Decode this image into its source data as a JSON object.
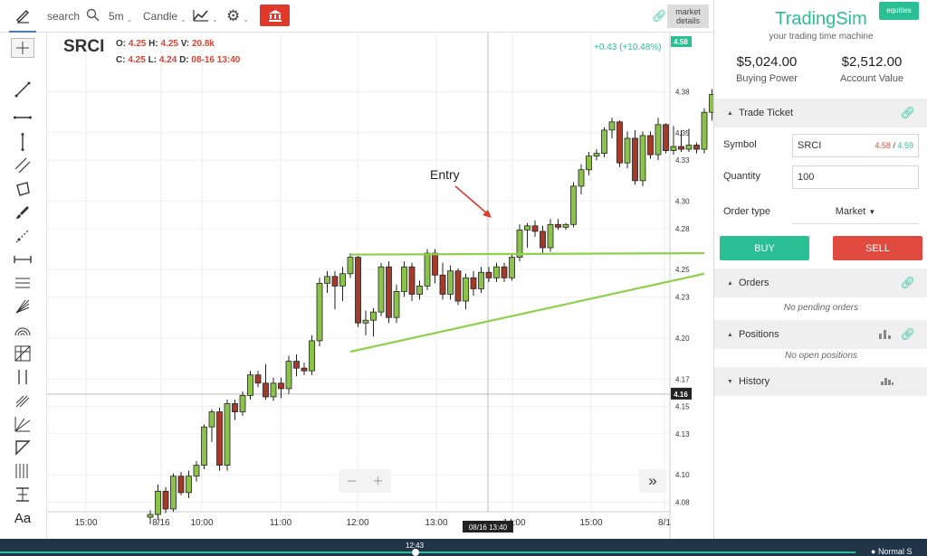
{
  "toolbar": {
    "search_label": "search",
    "interval": "5m",
    "chart_type": "Candle",
    "market_details_line1": "market",
    "market_details_line2": "details"
  },
  "symbol_header": {
    "symbol": "SRCI",
    "open_label": "O:",
    "open": "4.25",
    "high_label": "H:",
    "high": "4.25",
    "volume_label": "V:",
    "volume": "20.8k",
    "close_label": "C:",
    "close": "4.25",
    "low_label": "L:",
    "low": "4.24",
    "date_label": "D:",
    "date": "08-16 13:40",
    "change": "+0.43 (+10.48%)"
  },
  "chart_annotation": {
    "entry_label": "Entry"
  },
  "chart_data": {
    "type": "candlestick",
    "price_axis_ticks": [
      "4.38",
      "4.35",
      "4.33",
      "4.30",
      "4.28",
      "4.25",
      "4.23",
      "4.20",
      "4.17",
      "4.15",
      "4.13",
      "4.10",
      "4.08"
    ],
    "time_axis_ticks": [
      "15:00",
      "8/16",
      "10:00",
      "11:00",
      "12:00",
      "13:00",
      "14:00",
      "15:00",
      "8/1"
    ],
    "ylim": [
      4.075,
      4.42
    ],
    "last_price_label": "4.58",
    "crosshair_price_label": "4.16",
    "crosshair_price": 4.159,
    "crosshair_time_label": "08/16 13:40",
    "candles": [
      [
        4.069,
        4.074,
        4.064,
        4.071
      ],
      [
        4.071,
        4.093,
        4.067,
        4.088
      ],
      [
        4.088,
        4.091,
        4.072,
        4.075
      ],
      [
        4.075,
        4.101,
        4.073,
        4.099
      ],
      [
        4.099,
        4.102,
        4.085,
        4.087
      ],
      [
        4.087,
        4.103,
        4.083,
        4.099
      ],
      [
        4.099,
        4.11,
        4.095,
        4.107
      ],
      [
        4.107,
        4.137,
        4.104,
        4.135
      ],
      [
        4.135,
        4.148,
        4.124,
        4.146
      ],
      [
        4.146,
        4.149,
        4.103,
        4.107
      ],
      [
        4.107,
        4.155,
        4.103,
        4.152
      ],
      [
        4.152,
        4.155,
        4.14,
        4.146
      ],
      [
        4.146,
        4.161,
        4.143,
        4.158
      ],
      [
        4.158,
        4.176,
        4.155,
        4.173
      ],
      [
        4.173,
        4.176,
        4.164,
        4.167
      ],
      [
        4.167,
        4.181,
        4.155,
        4.157
      ],
      [
        4.157,
        4.171,
        4.154,
        4.167
      ],
      [
        4.167,
        4.171,
        4.156,
        4.163
      ],
      [
        4.163,
        4.187,
        4.159,
        4.183
      ],
      [
        4.183,
        4.188,
        4.172,
        4.178
      ],
      [
        4.178,
        4.182,
        4.173,
        4.176
      ],
      [
        4.176,
        4.202,
        4.173,
        4.198
      ],
      [
        4.198,
        4.244,
        4.194,
        4.24
      ],
      [
        4.24,
        4.249,
        4.233,
        4.245
      ],
      [
        4.245,
        4.249,
        4.221,
        4.238
      ],
      [
        4.238,
        4.252,
        4.227,
        4.247
      ],
      [
        4.247,
        4.262,
        4.244,
        4.259
      ],
      [
        4.259,
        4.26,
        4.208,
        4.211
      ],
      [
        4.211,
        4.22,
        4.202,
        4.213
      ],
      [
        4.213,
        4.222,
        4.201,
        4.219
      ],
      [
        4.219,
        4.255,
        4.216,
        4.252
      ],
      [
        4.252,
        4.256,
        4.211,
        4.215
      ],
      [
        4.215,
        4.239,
        4.211,
        4.234
      ],
      [
        4.234,
        4.256,
        4.23,
        4.252
      ],
      [
        4.252,
        4.255,
        4.227,
        4.232
      ],
      [
        4.232,
        4.242,
        4.228,
        4.238
      ],
      [
        4.238,
        4.265,
        4.235,
        4.262
      ],
      [
        4.262,
        4.265,
        4.24,
        4.246
      ],
      [
        4.246,
        4.255,
        4.228,
        4.232
      ],
      [
        4.232,
        4.253,
        4.228,
        4.249
      ],
      [
        4.249,
        4.251,
        4.224,
        4.227
      ],
      [
        4.227,
        4.247,
        4.221,
        4.244
      ],
      [
        4.244,
        4.249,
        4.231,
        4.236
      ],
      [
        4.236,
        4.252,
        4.233,
        4.248
      ],
      [
        4.248,
        4.252,
        4.241,
        4.244
      ],
      [
        4.244,
        4.255,
        4.241,
        4.252
      ],
      [
        4.252,
        4.255,
        4.241,
        4.244
      ],
      [
        4.244,
        4.262,
        4.242,
        4.259
      ],
      [
        4.259,
        4.283,
        4.256,
        4.279
      ],
      [
        4.279,
        4.284,
        4.266,
        4.282
      ],
      [
        4.282,
        4.286,
        4.274,
        4.278
      ],
      [
        4.278,
        4.282,
        4.262,
        4.266
      ],
      [
        4.266,
        4.287,
        4.263,
        4.283
      ],
      [
        4.283,
        4.287,
        4.279,
        4.281
      ],
      [
        4.281,
        4.284,
        4.279,
        4.283
      ],
      [
        4.283,
        4.314,
        4.281,
        4.311
      ],
      [
        4.311,
        4.327,
        4.305,
        4.323
      ],
      [
        4.323,
        4.336,
        4.319,
        4.333
      ],
      [
        4.333,
        4.338,
        4.33,
        4.335
      ],
      [
        4.335,
        4.354,
        4.332,
        4.352
      ],
      [
        4.352,
        4.361,
        4.346,
        4.358
      ],
      [
        4.358,
        4.359,
        4.325,
        4.328
      ],
      [
        4.328,
        4.351,
        4.324,
        4.346
      ],
      [
        4.346,
        4.352,
        4.312,
        4.315
      ],
      [
        4.315,
        4.351,
        4.311,
        4.348
      ],
      [
        4.348,
        4.351,
        4.331,
        4.334
      ],
      [
        4.334,
        4.361,
        4.33,
        4.356
      ],
      [
        4.356,
        4.357,
        4.335,
        4.337
      ],
      [
        4.337,
        4.355,
        4.334,
        4.34
      ],
      [
        4.34,
        4.352,
        4.336,
        4.338
      ],
      [
        4.338,
        4.353,
        4.336,
        4.341
      ],
      [
        4.341,
        4.343,
        4.335,
        4.338
      ],
      [
        4.338,
        4.368,
        4.335,
        4.365
      ],
      [
        4.365,
        4.382,
        4.359,
        4.378
      ],
      [
        4.378,
        4.381,
        4.348,
        4.351
      ],
      [
        4.351,
        4.371,
        4.34,
        4.367
      ],
      [
        4.367,
        4.42,
        4.362,
        4.418
      ]
    ],
    "annotations": [
      {
        "type": "trendline",
        "from": [
          26,
          4.261
        ],
        "to": [
          72,
          4.262
        ]
      },
      {
        "type": "trendline",
        "from": [
          26,
          4.19
        ],
        "to": [
          72,
          4.247
        ]
      }
    ]
  },
  "panel": {
    "brand": "TradingSim",
    "tagline": "your trading time machine",
    "equities_badge": "equities",
    "buying_power": "$5,024.00",
    "buying_power_label": "Buying Power",
    "account_value": "$2,512.00",
    "account_value_label": "Account Value",
    "trade_ticket_label": "Trade Ticket",
    "symbol_label": "Symbol",
    "symbol_value": "SRCI",
    "bid": "4.58",
    "ask_sep": "/",
    "ask": "4.59",
    "quantity_label": "Quantity",
    "quantity_value": "100",
    "order_type_label": "Order type",
    "order_type_value": "Market",
    "buy_label": "BUY",
    "sell_label": "SELL",
    "orders_label": "Orders",
    "no_orders": "No pending orders",
    "positions_label": "Positions",
    "no_positions": "No open positions",
    "history_label": "History"
  },
  "status_bar": {
    "time": "12:43",
    "mode": "Normal S"
  },
  "colors": {
    "up_candle": "#8bc34a",
    "down_candle": "#a63a2a",
    "trendline": "#8dd14a",
    "accent": "#2bbf94",
    "sell": "#e0493d",
    "annotation_arrow": "#e0392b"
  }
}
